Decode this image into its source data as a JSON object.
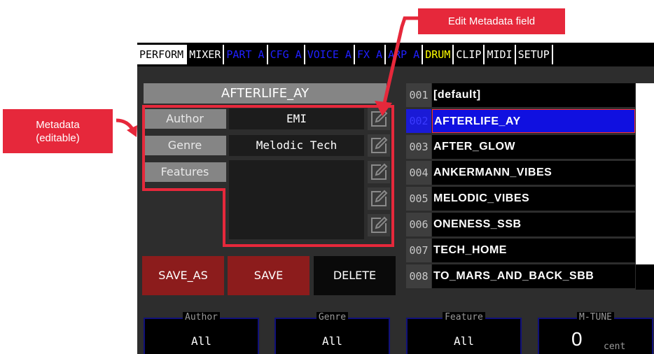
{
  "tabs": [
    {
      "label": "PERFORM",
      "style": "active"
    },
    {
      "label": "MIXER",
      "style": "white"
    },
    {
      "label": "PART A",
      "style": "blue"
    },
    {
      "label": "CFG A",
      "style": "blue"
    },
    {
      "label": "VOICE A",
      "style": "blue"
    },
    {
      "label": "FX A",
      "style": "blue"
    },
    {
      "label": "ARP A",
      "style": "blue"
    },
    {
      "label": "DRUM",
      "style": "yellow"
    },
    {
      "label": "CLIP",
      "style": "white"
    },
    {
      "label": "MIDI",
      "style": "white"
    },
    {
      "label": "SETUP",
      "style": "white"
    }
  ],
  "preset": {
    "title": "AFTERLIFE_AY",
    "author_label": "Author",
    "author_value": "EMI",
    "genre_label": "Genre",
    "genre_value": "Melodic Tech",
    "features_label": "Features"
  },
  "buttons": {
    "save_as": "SAVE_AS",
    "save": "SAVE",
    "delete": "DELETE"
  },
  "presets": [
    {
      "num": "001",
      "name": "[default]",
      "selected": false
    },
    {
      "num": "002",
      "name": "AFTERLIFE_AY",
      "selected": true
    },
    {
      "num": "003",
      "name": "AFTER_GLOW",
      "selected": false
    },
    {
      "num": "004",
      "name": "ANKERMANN_VIBES",
      "selected": false
    },
    {
      "num": "005",
      "name": "MELODIC_VIBES",
      "selected": false
    },
    {
      "num": "006",
      "name": "ONENESS_SSB",
      "selected": false
    },
    {
      "num": "007",
      "name": "TECH_HOME",
      "selected": false
    },
    {
      "num": "008",
      "name": "TO_MARS_AND_BACK_SBB",
      "selected": false
    }
  ],
  "filters": {
    "author_label": "Author",
    "author_value": "All",
    "genre_label": "Genre",
    "genre_value": "All",
    "feature_label": "Feature",
    "feature_value": "All",
    "mtune_label": "M-TUNE",
    "mtune_value": "0",
    "mtune_unit": "cent"
  },
  "annotations": {
    "edit_field": "Edit Metadata field",
    "metadata_line1": "Metadata",
    "metadata_line2": "(editable)"
  },
  "colors": {
    "accent_red": "#e6283b",
    "selection_blue": "#1010e0",
    "drum_yellow": "#ffff00"
  }
}
